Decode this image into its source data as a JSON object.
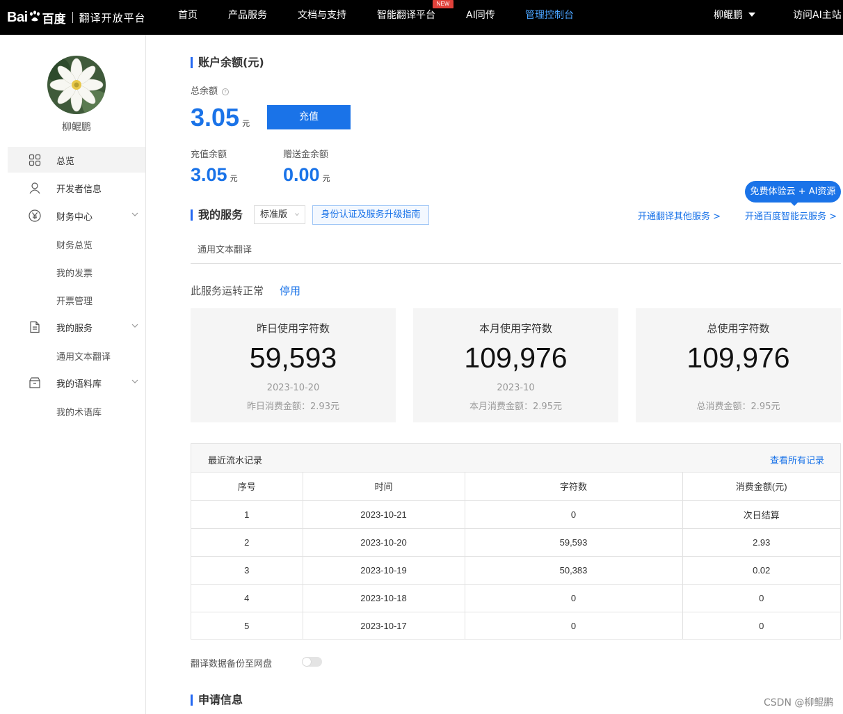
{
  "colors": {
    "brand_blue": "#1a73e8",
    "nav_bg": "#000000",
    "new_badge": "#e0413a"
  },
  "header": {
    "logo_text": "Bai",
    "logo_cn": "百度",
    "platform_title": "翻译开放平台",
    "nav": [
      "首页",
      "产品服务",
      "文档与支持",
      "智能翻译平台",
      "AI同传",
      "管理控制台"
    ],
    "new_badge": "NEW",
    "user": "柳鲲鹏",
    "visit_ai": "访问AI主站"
  },
  "sidebar": {
    "username": "柳鲲鹏",
    "items": [
      {
        "label": "总览",
        "icon": "grid-icon"
      },
      {
        "label": "开发者信息",
        "icon": "user-icon"
      },
      {
        "label": "财务中心",
        "icon": "yen-icon"
      },
      {
        "label": "我的服务",
        "icon": "document-icon"
      },
      {
        "label": "我的语料库",
        "icon": "box-icon"
      }
    ],
    "sub_finance": [
      "财务总览",
      "我的发票",
      "开票管理"
    ],
    "sub_service": [
      "通用文本翻译"
    ],
    "sub_corpus": [
      "我的术语库"
    ]
  },
  "balance": {
    "section_title": "账户余额(元)",
    "total_label": "总余额",
    "total_value": "3.05",
    "unit": "元",
    "recharge_btn": "充值",
    "recharge_label": "充值余额",
    "recharge_value": "3.05",
    "gift_label": "赠送金余额",
    "gift_value": "0.00"
  },
  "services": {
    "section_title": "我的服务",
    "edition": "标准版",
    "guide_btn": "身份认证及服务升级指南",
    "link_other": "开通翻译其他服务 >",
    "link_cloud": "开通百度智能云服务 >",
    "promo": "免费体验云 + AI资源",
    "tab": "通用文本翻译",
    "status_text": "此服务运转正常",
    "stop_link": "停用"
  },
  "cards": [
    {
      "title": "昨日使用字符数",
      "value": "59,593",
      "date": "2023-10-20",
      "cost": "昨日消费金额：2.93元"
    },
    {
      "title": "本月使用字符数",
      "value": "109,976",
      "date": "2023-10",
      "cost": "本月消费金额：2.95元"
    },
    {
      "title": "总使用字符数",
      "value": "109,976",
      "date": "",
      "cost": "总消费金额：2.95元"
    }
  ],
  "records": {
    "title": "最近流水记录",
    "view_all": "查看所有记录",
    "columns": [
      "序号",
      "时间",
      "字符数",
      "消费金额(元)"
    ],
    "rows": [
      [
        "1",
        "2023-10-21",
        "0",
        "次日结算"
      ],
      [
        "2",
        "2023-10-20",
        "59,593",
        "2.93"
      ],
      [
        "3",
        "2023-10-19",
        "50,383",
        "0.02"
      ],
      [
        "4",
        "2023-10-18",
        "0",
        "0"
      ],
      [
        "5",
        "2023-10-17",
        "0",
        "0"
      ]
    ]
  },
  "backup": {
    "label": "翻译数据备份至网盘",
    "enabled": false
  },
  "apply": {
    "section_title": "申请信息"
  },
  "watermark": "CSDN @柳鲲鹏"
}
